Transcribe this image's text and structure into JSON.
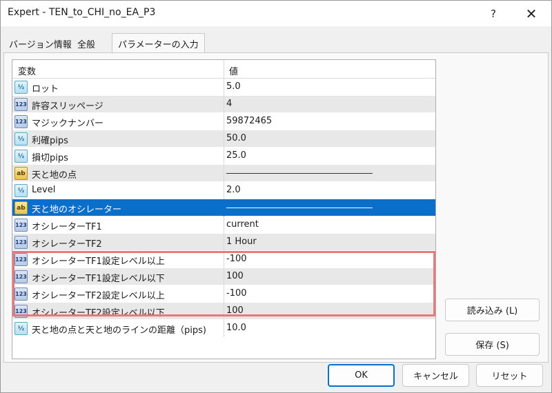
{
  "window": {
    "title": "Expert - TEN_to_CHI_no_EA_P3",
    "help_glyph": "?",
    "close_glyph": "✕"
  },
  "tabs": [
    {
      "label": "バージョン情報"
    },
    {
      "label": "全般"
    },
    {
      "label": "パラメーターの入力",
      "active": true
    }
  ],
  "grid": {
    "columns": [
      "変数",
      "値"
    ],
    "rows": [
      {
        "icon": "frac-icon",
        "glyph": "½",
        "name": "ロット",
        "value": "5.0"
      },
      {
        "icon": "int-icon",
        "glyph": "123",
        "name": "許容スリッページ",
        "value": "4"
      },
      {
        "icon": "int-icon",
        "glyph": "123",
        "name": "マジックナンバー",
        "value": "59872465"
      },
      {
        "icon": "frac-icon",
        "glyph": "½",
        "name": "利確pips",
        "value": "50.0"
      },
      {
        "icon": "frac-icon",
        "glyph": "½",
        "name": "損切pips",
        "value": "25.0"
      },
      {
        "icon": "string-icon",
        "glyph": "ab",
        "name": "天と地の点",
        "value": ""
      },
      {
        "icon": "frac-icon",
        "glyph": "½",
        "name": "Level",
        "value": "2.0"
      },
      {
        "icon": "string-icon",
        "glyph": "ab",
        "name": "天と地のオシレーター",
        "value": "",
        "selected": true
      },
      {
        "icon": "int-icon",
        "glyph": "123",
        "name": "オシレーターTF1",
        "value": "current"
      },
      {
        "icon": "int-icon",
        "glyph": "123",
        "name": "オシレーターTF2",
        "value": "1 Hour"
      },
      {
        "icon": "int-icon",
        "glyph": "123",
        "name": "オシレーターTF1設定レベル以上",
        "value": "-100"
      },
      {
        "icon": "int-icon",
        "glyph": "123",
        "name": "オシレーターTF1設定レベル以下",
        "value": "100"
      },
      {
        "icon": "int-icon",
        "glyph": "123",
        "name": "オシレーターTF2設定レベル以上",
        "value": "-100"
      },
      {
        "icon": "int-icon",
        "glyph": "123",
        "name": "オシレーターTF2設定レベル以下",
        "value": "100"
      },
      {
        "icon": "frac-icon",
        "glyph": "½",
        "name": "天と地の点と天と地のラインの距離（pips)",
        "value": "10.0"
      }
    ]
  },
  "buttons": {
    "load": "読み込み (L)",
    "save": "保存 (S)",
    "ok": "OK",
    "cancel": "キャンセル",
    "reset": "リセット"
  },
  "colors": {
    "selection": "#0a6ecb",
    "highlight_box": "#e8787a"
  }
}
